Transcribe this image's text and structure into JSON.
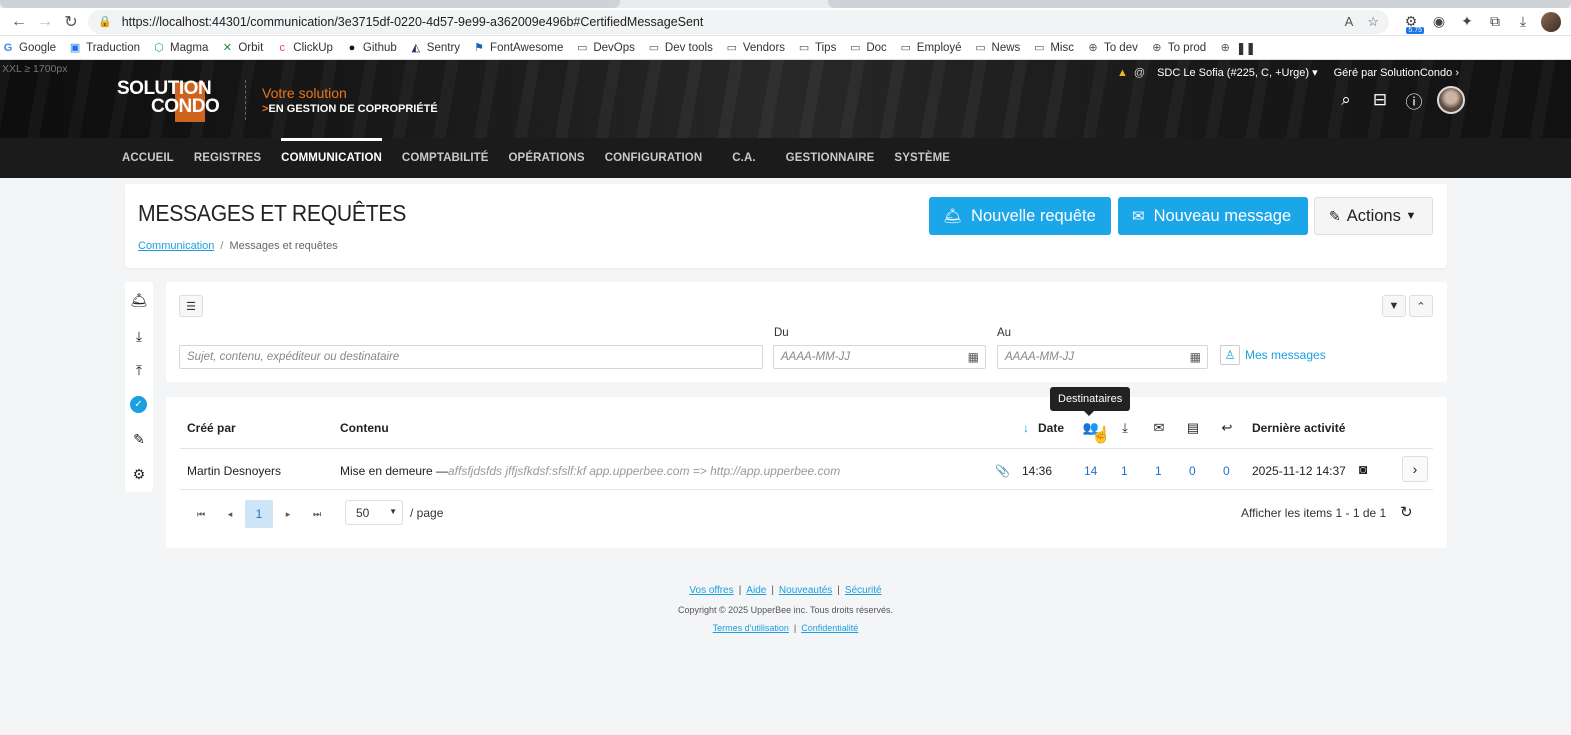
{
  "browser": {
    "url": "https://localhost:44301/communication/3e3715df-0220-4d57-9e99-a362009e496b#CertifiedMessageSent",
    "ext_badge": "5.75",
    "bookmarks": [
      "Google",
      "Traduction",
      "Magma",
      "Orbit",
      "ClickUp",
      "Github",
      "Sentry",
      "FontAwesome",
      "DevOps",
      "Dev tools",
      "Vendors",
      "Tips",
      "Doc",
      "Employé",
      "News",
      "Misc",
      "To dev",
      "To prod"
    ]
  },
  "header": {
    "breakpoint": "XXL ≥ 1700px",
    "logo": {
      "line1": "SOLUTION",
      "line2": "CONDO",
      "tag1": "Votre solution",
      "tag2": "EN GESTION DE COPROPRIÉTÉ"
    },
    "context": "SDC Le Sofia (#225, C, +Urge)",
    "managed_by": "Géré par  SolutionCondo"
  },
  "nav": [
    "ACCUEIL",
    "REGISTRES",
    "COMMUNICATION",
    "COMPTABILITÉ",
    "OPÉRATIONS",
    "CONFIGURATION",
    "C.A.",
    "GESTIONNAIRE",
    "SYSTÈME"
  ],
  "page": {
    "title": "MESSAGES ET REQUÊTES",
    "breadcrumb_link": "Communication",
    "breadcrumb_current": "Messages et requêtes",
    "btn_new_request": "Nouvelle requête",
    "btn_new_message": "Nouveau message",
    "btn_actions": "Actions"
  },
  "filter": {
    "search_placeholder": "Sujet, contenu, expéditeur ou destinataire",
    "from_label": "Du",
    "to_label": "Au",
    "date_placeholder": "AAAA-MM-JJ",
    "my_messages": "Mes messages"
  },
  "grid": {
    "columns": {
      "created_by": "Créé par",
      "content": "Contenu",
      "date": "Date",
      "last_activity": "Dernière activité"
    },
    "tooltip": "Destinataires",
    "row": {
      "author": "Martin Desnoyers",
      "subject": "Mise en demeure —",
      "preview": "affsfjdsfds jffjsfkdsf:sfslf:kf   app.upperbee.com => http://app.upperbee.com",
      "time": "14:36",
      "recipients": "14",
      "downloaded": "1",
      "opened": "1",
      "attachments_opened": "0",
      "replies": "0",
      "last_activity": "2025-11-12 14:37"
    },
    "pager": {
      "current": "1",
      "page_size": "50",
      "per_page": "/ page",
      "summary": "Afficher les items 1 - 1 de 1"
    }
  },
  "footer": {
    "links": [
      "Vos offres",
      "Aide",
      "Nouveautés",
      "Sécurité"
    ],
    "copyright": "Copyright © 2025 UpperBee inc. Tous droits réservés.",
    "legal": [
      "Termes d'utilisation",
      "Confidentialité"
    ]
  }
}
